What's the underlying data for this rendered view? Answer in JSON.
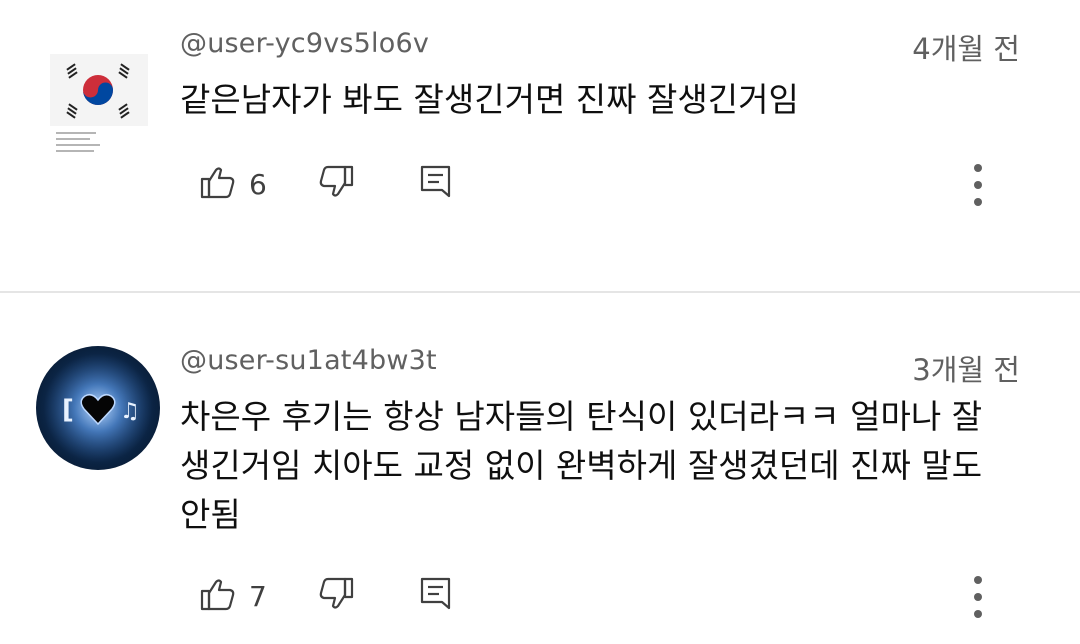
{
  "comments": [
    {
      "username": "@user-yc9vs5lo6v",
      "time": "4개월 전",
      "text": "같은남자가 봐도 잘생긴거면 진짜 잘생긴거임",
      "likes": "6"
    },
    {
      "username": "@user-su1at4bw3t",
      "time": "3개월 전",
      "text_lines": [
        "차은우 후기는 항상 남자들의 탄식이 있더라ㅋㅋ 얼마나 잘",
        "생긴거임 치아도 교정 없이 완벽하게 잘생겼던데 진짜 말도",
        "안됨"
      ],
      "likes": "7"
    }
  ],
  "icons": {
    "like": "thumbs-up-icon",
    "dislike": "thumbs-down-icon",
    "reply": "reply-icon",
    "more": "more-vert-icon"
  },
  "colors": {
    "meta_text": "#606060",
    "body_text": "#0f0f0f",
    "divider": "#e5e5e5"
  }
}
